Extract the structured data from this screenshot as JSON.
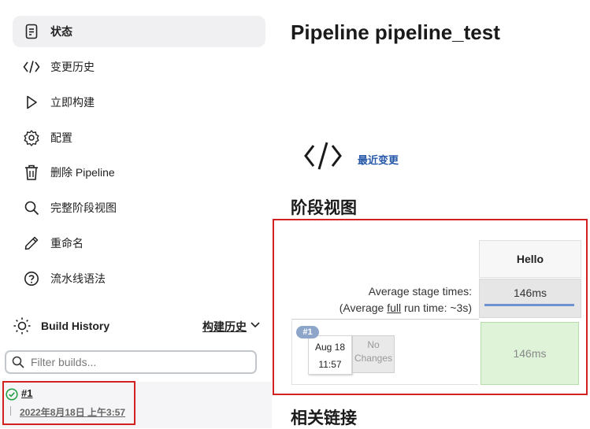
{
  "sidebar": {
    "items": [
      {
        "label": "状态",
        "icon": "status-document-icon",
        "active": true
      },
      {
        "label": "变更历史",
        "icon": "code-icon"
      },
      {
        "label": "立即构建",
        "icon": "play-icon"
      },
      {
        "label": "配置",
        "icon": "gear-icon"
      },
      {
        "label": "删除 Pipeline",
        "icon": "trash-icon"
      },
      {
        "label": "完整阶段视图",
        "icon": "search-icon"
      },
      {
        "label": "重命名",
        "icon": "pencil-icon"
      },
      {
        "label": "流水线语法",
        "icon": "help-icon"
      }
    ]
  },
  "build_history": {
    "title": "Build History",
    "link_label": "构建历史",
    "filter_placeholder": "Filter builds...",
    "builds": [
      {
        "number": "#1",
        "date": "2022年8月18日 上午3:57",
        "status": "success"
      }
    ]
  },
  "main": {
    "title": "Pipeline pipeline_test",
    "recent_changes": "最近变更",
    "stage_view_heading": "阶段视图",
    "related_links_heading": "相关链接"
  },
  "stage_view": {
    "avg_label": "Average stage times:",
    "avg_full_prefix": "(Average ",
    "avg_full_link": "full",
    "avg_full_suffix": " run time: ~3s)",
    "stage_name": "Hello",
    "stage_avg": "146ms",
    "run": {
      "badge": "#1",
      "date": "Aug 18",
      "time": "11:57",
      "changes_line1": "No",
      "changes_line2": "Changes",
      "stage_time": "146ms"
    }
  },
  "colors": {
    "highlight": "#d32020",
    "success": "#1e9e3e",
    "link": "#2457a8",
    "stage_success_bg": "#dff3d9"
  }
}
